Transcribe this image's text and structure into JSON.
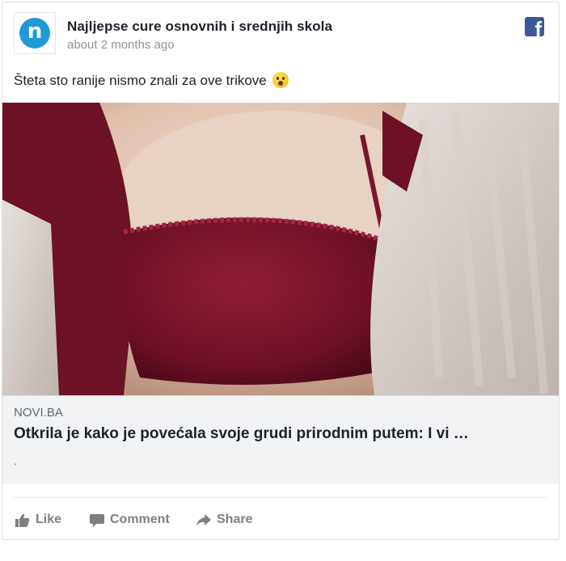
{
  "post": {
    "page_name": "Najljepse cure osnovnih i srednjih skola",
    "timestamp": "about 2 months ago",
    "text": "Šteta sto ranije nismo znali za ove trikove",
    "avatar_letter": "n",
    "avatar_color": "#1f9ad6"
  },
  "link": {
    "domain": "NOVI.BA",
    "headline": "Otkrila je kako je povećala svoje grudi prirodnim putem: I vi …",
    "description": "."
  },
  "actions": {
    "like": "Like",
    "comment": "Comment",
    "share": "Share"
  },
  "icons": {
    "brand": "facebook-icon",
    "emoji": "astonished-face-emoji",
    "like": "thumbs-up-icon",
    "comment": "comment-bubble-icon",
    "share": "share-arrow-icon"
  },
  "colors": {
    "facebook_blue": "#3b5998",
    "link_preview_bg": "#f2f3f5",
    "muted_text": "#90949c",
    "action_text": "#7f7f7f"
  }
}
